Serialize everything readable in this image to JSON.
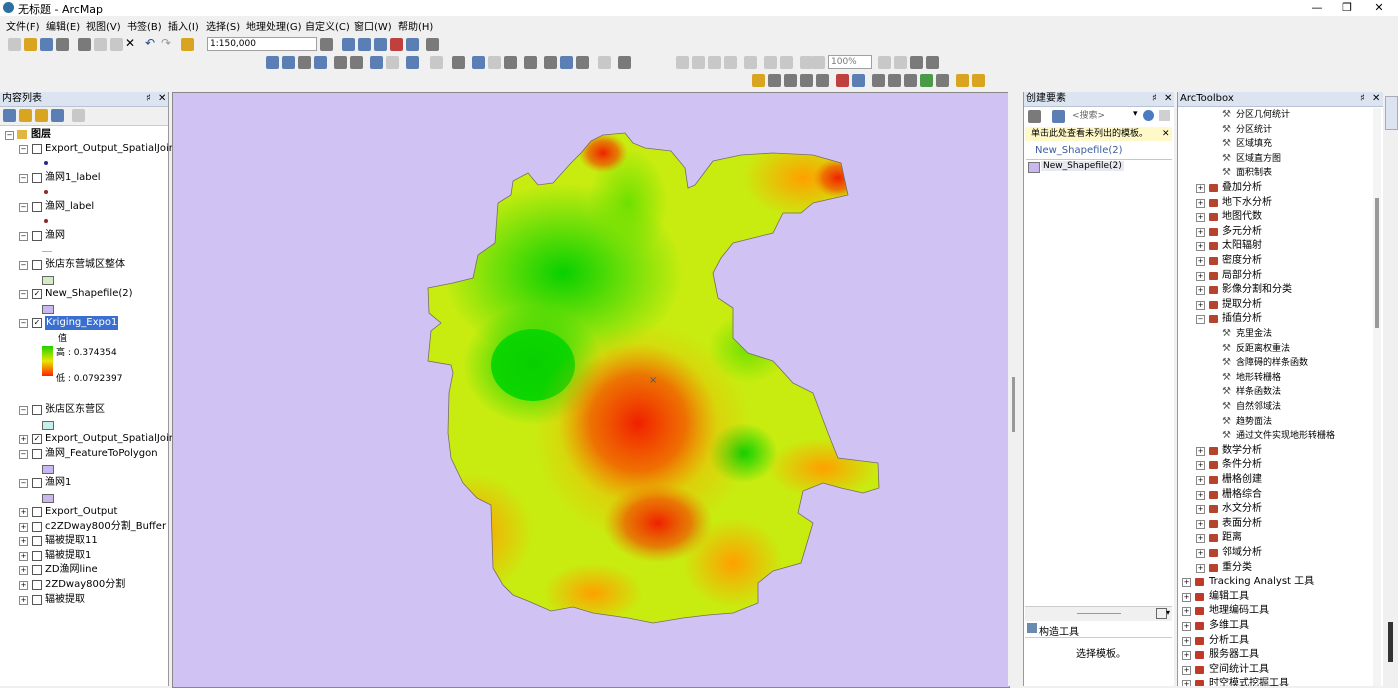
{
  "window": {
    "title": "无标题 - ArcMap",
    "minimize": "—",
    "maximize": "❐",
    "close": "✕"
  },
  "menu": [
    "文件(F)",
    "编辑(E)",
    "视图(V)",
    "书签(B)",
    "插入(I)",
    "选择(S)",
    "地理处理(G)",
    "自定义(C)",
    "窗口(W)",
    "帮助(H)"
  ],
  "toolbar": {
    "scale": "1:150,000",
    "zoom": "100%"
  },
  "toc": {
    "title": "内容列表",
    "root": "图层",
    "layers": [
      {
        "name": "Export_Output_SpatialJoin_Fe",
        "checked": false,
        "symbol": "dot",
        "color": "#2a2a8a"
      },
      {
        "name": "渔网1_label",
        "checked": false,
        "symbol": "dot",
        "color": "#8b2a2a"
      },
      {
        "name": "渔网_label",
        "checked": false,
        "symbol": "dot",
        "color": "#8b2a2a"
      },
      {
        "name": "渔网",
        "checked": false,
        "symbol": "line",
        "color": "#c9b27a"
      },
      {
        "name": "张店东营城区整体",
        "checked": false,
        "symbol": "fill",
        "color": "#d3ecc0"
      },
      {
        "name": "New_Shapefile(2)",
        "checked": true,
        "symbol": "fill",
        "color": "#c9b8f0"
      },
      {
        "name": "Kriging_Expo1",
        "checked": true,
        "symbol": "ramp"
      },
      {
        "name": "张店区东营区",
        "checked": false,
        "symbol": "fill",
        "color": "#c6eeea"
      },
      {
        "name": "Export_Output_SpatialJoin",
        "checked": true,
        "symbol": "none"
      },
      {
        "name": "渔网_FeatureToPolygon",
        "checked": false,
        "symbol": "fill",
        "color": "#c9b8f0"
      },
      {
        "name": "渔网1",
        "checked": false,
        "symbol": "fill",
        "color": "#c9b8f0"
      },
      {
        "name": "Export_Output",
        "checked": false,
        "symbol": "none"
      },
      {
        "name": "c2ZDway800分割_Buffer",
        "checked": false,
        "symbol": "none"
      },
      {
        "name": "辐被提取11",
        "checked": false,
        "symbol": "none"
      },
      {
        "name": "辐被提取1",
        "checked": false,
        "symbol": "none"
      },
      {
        "name": "ZD渔网line",
        "checked": false,
        "symbol": "none"
      },
      {
        "name": "2ZDway800分割",
        "checked": false,
        "symbol": "none"
      },
      {
        "name": "辐被提取",
        "checked": false,
        "symbol": "none"
      }
    ],
    "ramp_label": "值",
    "ramp_high": "高 : 0.374354",
    "ramp_low": "低 : 0.0792397"
  },
  "create_features": {
    "title": "创建要素",
    "search_placeholder": "<搜索>",
    "notice": "单击此处查看未列出的模板。",
    "group": "New_Shapefile(2)",
    "item": "New_Shapefile(2)",
    "construction_title": "构造工具",
    "construction_hint": "选择模板。"
  },
  "toolbox": {
    "title": "ArcToolbox",
    "items": [
      {
        "label": "分区几何统计",
        "level": 3,
        "kind": "tool"
      },
      {
        "label": "分区统计",
        "level": 3,
        "kind": "tool"
      },
      {
        "label": "区域填充",
        "level": 3,
        "kind": "tool"
      },
      {
        "label": "区域直方图",
        "level": 3,
        "kind": "tool"
      },
      {
        "label": "面积制表",
        "level": 3,
        "kind": "tool"
      },
      {
        "label": "叠加分析",
        "level": 2,
        "kind": "set"
      },
      {
        "label": "地下水分析",
        "level": 2,
        "kind": "set"
      },
      {
        "label": "地图代数",
        "level": 2,
        "kind": "set"
      },
      {
        "label": "多元分析",
        "level": 2,
        "kind": "set"
      },
      {
        "label": "太阳辐射",
        "level": 2,
        "kind": "set"
      },
      {
        "label": "密度分析",
        "level": 2,
        "kind": "set"
      },
      {
        "label": "局部分析",
        "level": 2,
        "kind": "set"
      },
      {
        "label": "影像分割和分类",
        "level": 2,
        "kind": "set"
      },
      {
        "label": "提取分析",
        "level": 2,
        "kind": "set"
      },
      {
        "label": "插值分析",
        "level": 2,
        "kind": "set-open"
      },
      {
        "label": "克里金法",
        "level": 3,
        "kind": "tool"
      },
      {
        "label": "反距离权重法",
        "level": 3,
        "kind": "tool"
      },
      {
        "label": "含障碍的样条函数",
        "level": 3,
        "kind": "tool"
      },
      {
        "label": "地形转栅格",
        "level": 3,
        "kind": "tool"
      },
      {
        "label": "样条函数法",
        "level": 3,
        "kind": "tool"
      },
      {
        "label": "自然邻域法",
        "level": 3,
        "kind": "tool"
      },
      {
        "label": "趋势面法",
        "level": 3,
        "kind": "tool"
      },
      {
        "label": "通过文件实现地形转栅格",
        "level": 3,
        "kind": "tool"
      },
      {
        "label": "数学分析",
        "level": 2,
        "kind": "set"
      },
      {
        "label": "条件分析",
        "level": 2,
        "kind": "set"
      },
      {
        "label": "栅格创建",
        "level": 2,
        "kind": "set"
      },
      {
        "label": "栅格综合",
        "level": 2,
        "kind": "set"
      },
      {
        "label": "水文分析",
        "level": 2,
        "kind": "set"
      },
      {
        "label": "表面分析",
        "level": 2,
        "kind": "set"
      },
      {
        "label": "距离",
        "level": 2,
        "kind": "set"
      },
      {
        "label": "邻域分析",
        "level": 2,
        "kind": "set"
      },
      {
        "label": "重分类",
        "level": 2,
        "kind": "set"
      },
      {
        "label": "Tracking Analyst 工具",
        "level": 1,
        "kind": "box"
      },
      {
        "label": "编辑工具",
        "level": 1,
        "kind": "box"
      },
      {
        "label": "地理编码工具",
        "level": 1,
        "kind": "box"
      },
      {
        "label": "多维工具",
        "level": 1,
        "kind": "box"
      },
      {
        "label": "分析工具",
        "level": 1,
        "kind": "box"
      },
      {
        "label": "服务器工具",
        "level": 1,
        "kind": "box"
      },
      {
        "label": "空间统计工具",
        "level": 1,
        "kind": "box"
      },
      {
        "label": "时空模式挖掘工具",
        "level": 1,
        "kind": "box"
      }
    ]
  }
}
